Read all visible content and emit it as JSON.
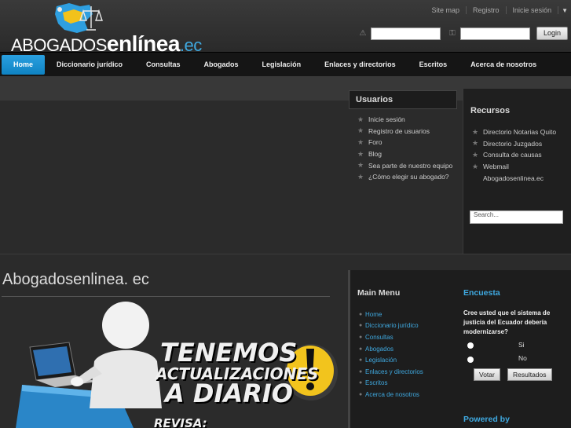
{
  "brand": {
    "logo_main": "ABOGADOS",
    "logo_accent": "enlínea",
    "logo_suffix": ".ec"
  },
  "top_links": [
    "Site map",
    "Registro",
    "Inicie sesión"
  ],
  "login": {
    "button": "Login"
  },
  "nav": [
    "Home",
    "Diccionario jurídico",
    "Consultas",
    "Abogados",
    "Legislación",
    "Enlaces y directorios",
    "Escritos",
    "Acerca de nosotros"
  ],
  "usuarios": {
    "title": "Usuarios",
    "items": [
      "Inicie sesión",
      "Registro de usuarios",
      "Foro",
      "Blog",
      "Sea parte de nuestro equipo",
      "¿Cómo elegir su abogado?"
    ]
  },
  "recursos": {
    "title": "Recursos",
    "items": [
      "Directorio Notarias Quito",
      "Directorio Juzgados",
      "Consulta de causas",
      "Webmail",
      "Abogadosenlinea.ec"
    ],
    "search_placeholder": "Search..."
  },
  "site_title": "Abogadosenlinea. ec",
  "banner": {
    "line1": "TENEMOS",
    "line2": "ACTUALIZACIONES",
    "line3": "A DIARIO",
    "line4": "REVISA:"
  },
  "main_menu": {
    "title": "Main Menu",
    "items": [
      "Home",
      "Diccionario jurídico",
      "Consultas",
      "Abogados",
      "Legislación",
      "Enlaces y directorios",
      "Escritos",
      "Acerca de nosotros"
    ]
  },
  "encuesta": {
    "title": "Encuesta",
    "question": "Cree usted que el sistema de justicia del Ecuador debería modernizarse?",
    "options": [
      "Si",
      "No"
    ],
    "vote": "Votar",
    "results": "Resultados"
  },
  "powered_by": "Powered by",
  "colors": {
    "accent": "#1a93d4",
    "link": "#3fa9e0",
    "background": "#2b2b2b"
  }
}
